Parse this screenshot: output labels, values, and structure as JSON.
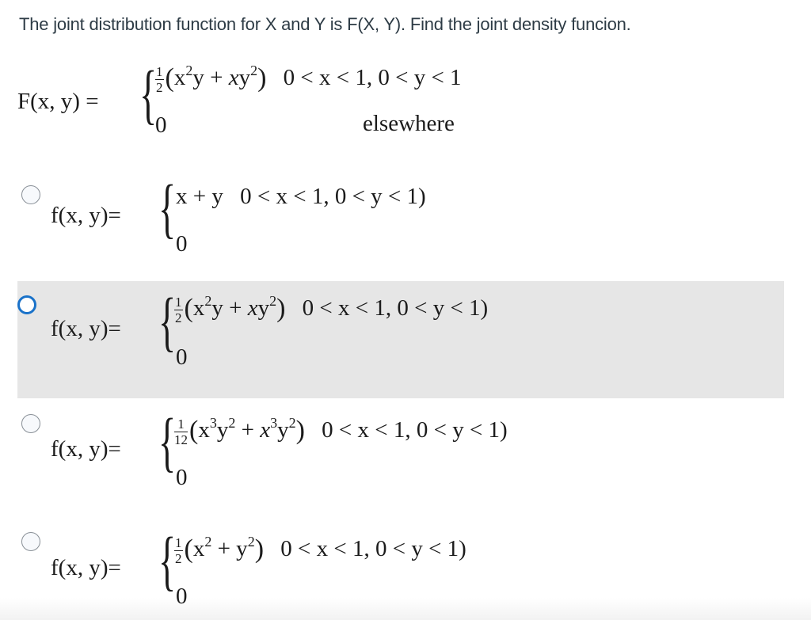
{
  "question": {
    "text": "The joint distribution function for X and Y is F(X, Y). Find the joint density funcion."
  },
  "given": {
    "lhs": "F(x, y) =",
    "case1": {
      "coef_num": "1",
      "coef_den": "2",
      "expr_html": "x²y + xy²",
      "condition": "0 < x < 1, 0 < y < 1"
    },
    "case2": {
      "value": "0",
      "condition": "elsewhere"
    }
  },
  "options": [
    {
      "lhs": "f(x, y)=",
      "case1_expr": "x + y",
      "coef": null,
      "condition": "0 < x < 1, 0 < y < 1)",
      "case2_value": "0",
      "selected": false,
      "highlighted": false
    },
    {
      "lhs": "f(x, y)=",
      "coef_num": "1",
      "coef_den": "2",
      "case1_expr": "x²y + xy²",
      "condition": "0 < x < 1, 0 < y < 1)",
      "case2_value": "0",
      "selected": false,
      "highlighted": true
    },
    {
      "lhs": "f(x, y)=",
      "coef_num": "1",
      "coef_den": "12",
      "case1_expr": "x³y² + x³y²",
      "condition": "0 < x < 1, 0 < y < 1)",
      "case2_value": "0",
      "selected": false,
      "highlighted": false
    },
    {
      "lhs": "f(x, y)=",
      "coef_num": "1",
      "coef_den": "2",
      "case1_expr": "x² + y²",
      "condition": "0 < x < 1, 0 < y < 1)",
      "case2_value": "0",
      "selected": false,
      "highlighted": false
    }
  ],
  "colors": {
    "text": "#2d3b45",
    "highlight_bg": "#e6e6e6",
    "radio_focus": "#1a72c9",
    "radio_border": "#888f96"
  }
}
